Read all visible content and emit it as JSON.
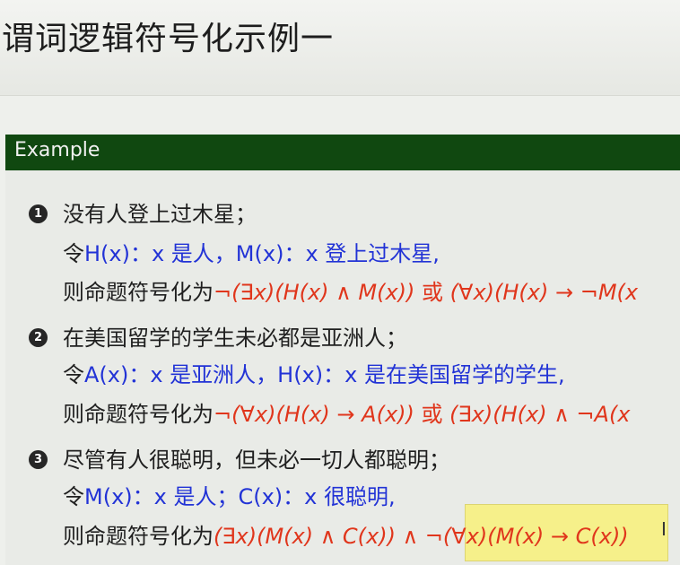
{
  "title": "谓词逻辑符号化示例一",
  "example_header": "Example",
  "items": [
    {
      "num": "1",
      "sentence": "没有人登上过木星；",
      "def_prefix": "令",
      "def": "H(x)：x 是人，M(x)：x 登上过木星,",
      "sym_prefix": "则命题符号化为",
      "formula1": "¬(∃x)(H(x) ∧ M(x))",
      "or": "或",
      "formula2": "(∀x)(H(x) → ¬M(x"
    },
    {
      "num": "2",
      "sentence": "在美国留学的学生未必都是亚洲人；",
      "def_prefix": "令",
      "def": "A(x)：x 是亚洲人，H(x)：x 是在美国留学的学生,",
      "sym_prefix": "则命题符号化为",
      "formula1": "¬(∀x)(H(x) → A(x))",
      "or": "或",
      "formula2": "(∃x)(H(x) ∧ ¬A(x"
    },
    {
      "num": "3",
      "sentence": "尽管有人很聪明，但未必一切人都聪明；",
      "def_prefix": "令",
      "def": "M(x)：x 是人；C(x)：x 很聪明,",
      "sym_prefix": "则命题符号化为",
      "formula1": "(∃x)(M(x) ∧ C(x)) ∧ ¬(∀x)(M(x) → C(x))",
      "or": "",
      "formula2": ""
    }
  ]
}
